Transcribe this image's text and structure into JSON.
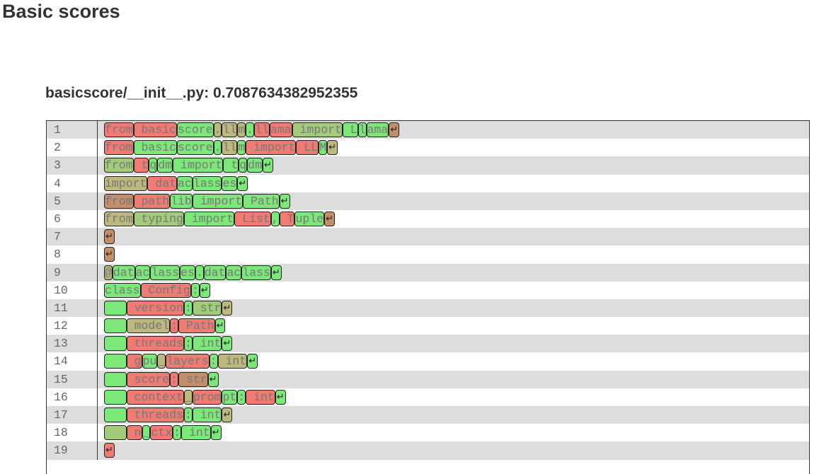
{
  "page_title": "Basic scores",
  "file_heading": "basicscore/__init__.py: 0.7087634382952355",
  "colors": {
    "r": "#ef7b73",
    "g": "#7de87a",
    "o": "#bcb87e",
    "b": "#c38e6a",
    "k": "#a2cc7c"
  },
  "lines": [
    {
      "num": "1",
      "tokens": [
        [
          "from",
          "r"
        ],
        [
          " basic",
          "r"
        ],
        [
          "score",
          "g"
        ],
        [
          ".",
          "o"
        ],
        [
          "ll",
          "o"
        ],
        [
          "m",
          "o"
        ],
        [
          ".",
          "g"
        ],
        [
          "ll",
          "r"
        ],
        [
          "ama",
          "r"
        ],
        [
          " import",
          "k"
        ],
        [
          " L",
          "g"
        ],
        [
          "l",
          "g"
        ],
        [
          "ama",
          "g"
        ],
        [
          "↵",
          "b"
        ]
      ]
    },
    {
      "num": "2",
      "tokens": [
        [
          "from",
          "r"
        ],
        [
          " basic",
          "g"
        ],
        [
          "score",
          "g"
        ],
        [
          ".",
          "g"
        ],
        [
          "ll",
          "o"
        ],
        [
          "m",
          "g"
        ],
        [
          " import",
          "r"
        ],
        [
          " LL",
          "r"
        ],
        [
          "M",
          "g"
        ],
        [
          "↵",
          "o"
        ]
      ]
    },
    {
      "num": "3",
      "tokens": [
        [
          "from",
          "k"
        ],
        [
          " t",
          "r"
        ],
        [
          "q",
          "g"
        ],
        [
          "dm",
          "g"
        ],
        [
          " import",
          "g"
        ],
        [
          " t",
          "g"
        ],
        [
          "q",
          "g"
        ],
        [
          "dm",
          "g"
        ],
        [
          "↵",
          "g"
        ]
      ]
    },
    {
      "num": "4",
      "tokens": [
        [
          "import",
          "o"
        ],
        [
          " dat",
          "r"
        ],
        [
          "ac",
          "g"
        ],
        [
          "lass",
          "g"
        ],
        [
          "es",
          "g"
        ],
        [
          "↵",
          "g"
        ]
      ]
    },
    {
      "num": "5",
      "tokens": [
        [
          "from",
          "b"
        ],
        [
          " path",
          "r"
        ],
        [
          "lib",
          "g"
        ],
        [
          " import",
          "g"
        ],
        [
          " Path",
          "g"
        ],
        [
          "↵",
          "g"
        ]
      ]
    },
    {
      "num": "6",
      "tokens": [
        [
          "from",
          "o"
        ],
        [
          " typing",
          "k"
        ],
        [
          " import",
          "g"
        ],
        [
          " List",
          "r"
        ],
        [
          ",",
          "g"
        ],
        [
          " T",
          "r"
        ],
        [
          "uple",
          "g"
        ],
        [
          "↵",
          "b"
        ]
      ]
    },
    {
      "num": "7",
      "tokens": [
        [
          "↵",
          "b"
        ]
      ]
    },
    {
      "num": "8",
      "tokens": [
        [
          "↵",
          "b"
        ]
      ]
    },
    {
      "num": "9",
      "tokens": [
        [
          "@",
          "o"
        ],
        [
          "dat",
          "g"
        ],
        [
          "ac",
          "g"
        ],
        [
          "lass",
          "g"
        ],
        [
          "es",
          "g"
        ],
        [
          ".",
          "g"
        ],
        [
          "dat",
          "g"
        ],
        [
          "ac",
          "g"
        ],
        [
          "lass",
          "g"
        ],
        [
          "↵",
          "g"
        ]
      ]
    },
    {
      "num": "10",
      "tokens": [
        [
          "class",
          "g"
        ],
        [
          " Config",
          "r"
        ],
        [
          ":",
          "g"
        ],
        [
          "↵",
          "g"
        ]
      ]
    },
    {
      "num": "11",
      "tokens": [
        [
          "   ",
          "g"
        ],
        [
          " version",
          "r"
        ],
        [
          ":",
          "g"
        ],
        [
          " str",
          "k"
        ],
        [
          "↵",
          "o"
        ]
      ]
    },
    {
      "num": "12",
      "tokens": [
        [
          "   ",
          "g"
        ],
        [
          " model",
          "o"
        ],
        [
          ":",
          "r"
        ],
        [
          " Path",
          "r"
        ],
        [
          "↵",
          "g"
        ]
      ]
    },
    {
      "num": "13",
      "tokens": [
        [
          "   ",
          "g"
        ],
        [
          " threads",
          "r"
        ],
        [
          ":",
          "g"
        ],
        [
          " int",
          "g"
        ],
        [
          "↵",
          "g"
        ]
      ]
    },
    {
      "num": "14",
      "tokens": [
        [
          "   ",
          "g"
        ],
        [
          " g",
          "r"
        ],
        [
          "pu",
          "g"
        ],
        [
          "_",
          "o"
        ],
        [
          "layers",
          "r"
        ],
        [
          ":",
          "g"
        ],
        [
          " int",
          "o"
        ],
        [
          "↵",
          "g"
        ]
      ]
    },
    {
      "num": "15",
      "tokens": [
        [
          "   ",
          "g"
        ],
        [
          " score",
          "r"
        ],
        [
          ":",
          "r"
        ],
        [
          " str",
          "b"
        ],
        [
          "↵",
          "g"
        ]
      ]
    },
    {
      "num": "16",
      "tokens": [
        [
          "   ",
          "g"
        ],
        [
          " context",
          "r"
        ],
        [
          "_",
          "o"
        ],
        [
          "prom",
          "r"
        ],
        [
          "pt",
          "g"
        ],
        [
          ":",
          "g"
        ],
        [
          " int",
          "r"
        ],
        [
          "↵",
          "g"
        ]
      ]
    },
    {
      "num": "17",
      "tokens": [
        [
          "   ",
          "g"
        ],
        [
          " threads",
          "r"
        ],
        [
          ":",
          "g"
        ],
        [
          " int",
          "g"
        ],
        [
          "↵",
          "o"
        ]
      ]
    },
    {
      "num": "18",
      "tokens": [
        [
          "   ",
          "k"
        ],
        [
          " n",
          "r"
        ],
        [
          "_",
          "g"
        ],
        [
          "ctx",
          "r"
        ],
        [
          ":",
          "g"
        ],
        [
          " int",
          "g"
        ],
        [
          "↵",
          "g"
        ]
      ]
    },
    {
      "num": "19",
      "tokens": [
        [
          "↵",
          "r"
        ]
      ]
    }
  ]
}
